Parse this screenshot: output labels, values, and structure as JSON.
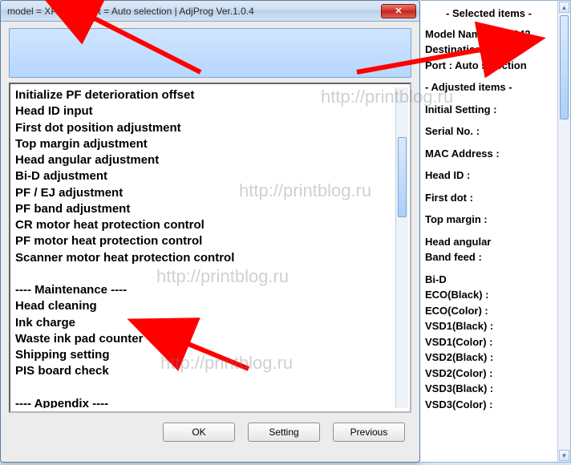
{
  "window": {
    "title": "model = XP-342 | port = Auto selection | AdjProg Ver.1.0.4",
    "close_label": "✕"
  },
  "list": [
    "Initialize PF deterioration offset",
    "Head ID input",
    "First dot position adjustment",
    "Top margin adjustment",
    "Head angular adjustment",
    "Bi-D adjustment",
    "PF / EJ adjustment",
    "PF band adjustment",
    "CR motor heat protection control",
    "PF motor heat protection control",
    "Scanner motor heat protection control",
    "",
    "---- Maintenance ----",
    "Head cleaning",
    "Ink charge",
    "Waste ink pad counter",
    "Shipping setting",
    "PIS board check",
    "",
    "---- Appendix ----"
  ],
  "buttons": {
    "ok": "OK",
    "setting": "Setting",
    "previous": "Previous"
  },
  "side": {
    "header": "- Selected items -",
    "model_line": "Model Name : XP-342",
    "dest_line": "Destination : ESP",
    "port_line": "Port : Auto selection",
    "adjusted_header": "- Adjusted items -",
    "lines": [
      "Initial Setting :",
      "Serial No. :",
      "MAC Address :",
      "Head ID :",
      "First dot :",
      "Top margin :"
    ],
    "head_angular_l1": "Head angular",
    "head_angular_l2": " Band feed :",
    "bid_header": "Bi-D",
    "bid_lines": [
      " ECO(Black) :",
      " ECO(Color) :",
      " VSD1(Black) :",
      " VSD1(Color) :",
      " VSD2(Black) :",
      " VSD2(Color) :",
      " VSD3(Black) :",
      " VSD3(Color) :"
    ]
  },
  "watermark": "http://printblog.ru"
}
